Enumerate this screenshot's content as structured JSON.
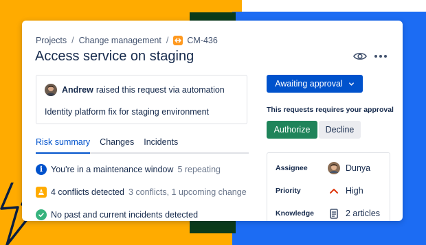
{
  "breadcrumb": {
    "items": [
      "Projects",
      "Change management"
    ],
    "separator": "/",
    "issue_key": "CM-436",
    "issue_icon": "change-arrows-icon"
  },
  "issue": {
    "title": "Access service on staging"
  },
  "header_actions": {
    "watch_icon": "eye-icon",
    "more_icon": "more-horizontal-icon"
  },
  "request": {
    "author": "Andrew",
    "action_text": "raised this request via automation",
    "description": "Identity platform fix for staging environment"
  },
  "tabs": [
    {
      "label": "Risk summary",
      "active": true
    },
    {
      "label": "Changes",
      "active": false
    },
    {
      "label": "Incidents",
      "active": false
    }
  ],
  "risks": [
    {
      "icon": "info-icon",
      "main": "You're in a maintenance window",
      "sub": "5 repeating"
    },
    {
      "icon": "warning-icon",
      "main": "4 conflicts detected",
      "sub": "3 conflicts, 1 upcoming change"
    },
    {
      "icon": "check-circle-icon",
      "main": "No past and current incidents detected",
      "sub": ""
    }
  ],
  "status": {
    "label": "Awaiting approval",
    "icon": "chevron-down-icon"
  },
  "approval": {
    "prompt": "This requests requires your approval",
    "authorize_label": "Authorize",
    "decline_label": "Decline"
  },
  "details": [
    {
      "label": "Assignee",
      "value": "Dunya",
      "icon": "avatar"
    },
    {
      "label": "Priority",
      "value": "High",
      "icon": "priority-high-icon"
    },
    {
      "label": "Knowledge",
      "value": "2 articles",
      "icon": "document-icon"
    }
  ],
  "colors": {
    "accent_blue": "#0052cc",
    "authorize_green": "#1f845a",
    "warning_orange": "#ffab00",
    "success_green": "#36b37e",
    "priority_red": "#de350b",
    "backdrop_orange": "#ffab00",
    "backdrop_blue": "#1c6cf3",
    "backdrop_dark_green": "#0b3b1a"
  }
}
